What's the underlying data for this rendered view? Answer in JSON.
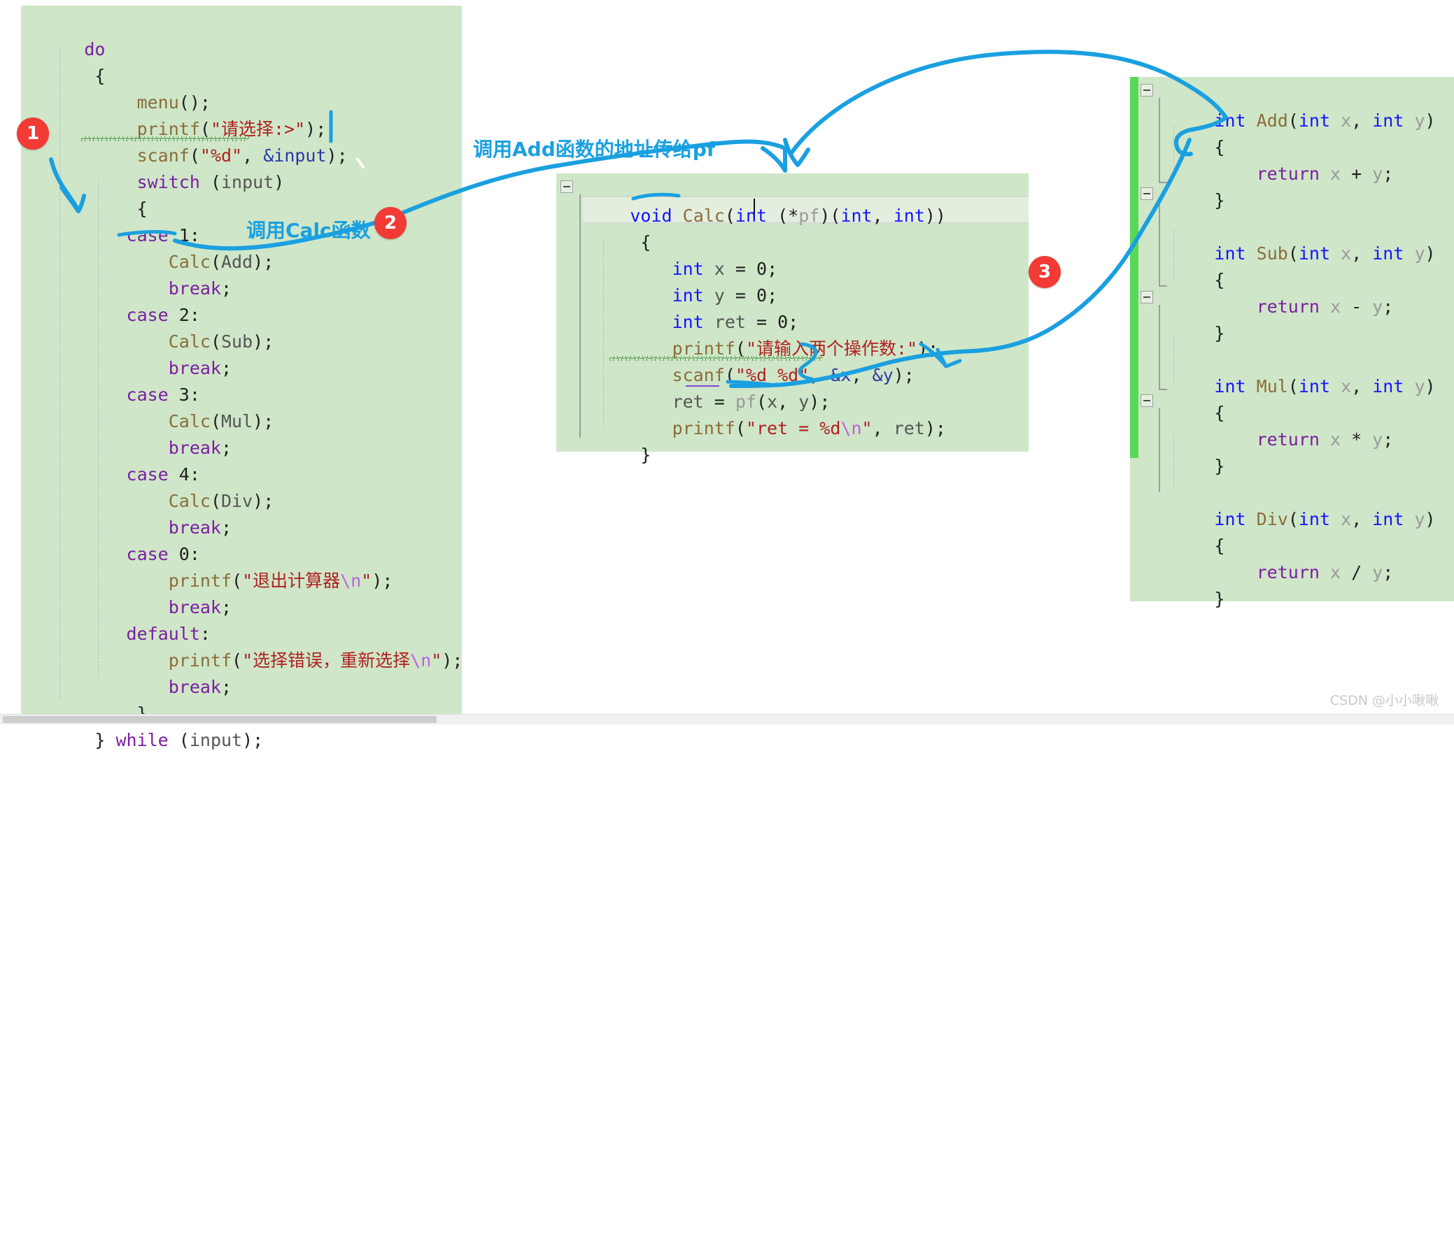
{
  "colors": {
    "code_background": "#cfe6c8",
    "page_background": "#ffffff",
    "annotation_blue": "#1aa0e0",
    "badge_red": "#f23b34",
    "changed_gutter_green": "#57d957",
    "keyword_purple": "#7b1fa2",
    "type_blue": "#1414ff",
    "function_brown": "#8a6d3b",
    "string_red": "#b02020",
    "escape_violet": "#c060e0",
    "squiggle_green": "#1f7a1f"
  },
  "panels": {
    "left": {
      "name": "main-switch-loop",
      "lines": [
        "do",
        "{",
        "    menu();",
        "    printf(\"请选择:>\");",
        "    scanf(\"%d\", &input);",
        "    switch (input)",
        "    {",
        "    case 1:",
        "        Calc(Add);",
        "        break;",
        "    case 2:",
        "        Calc(Sub);",
        "        break;",
        "    case 3:",
        "        Calc(Mul);",
        "        break;",
        "    case 4:",
        "        Calc(Div);",
        "        break;",
        "    case 0:",
        "        printf(\"退出计算器\\n\");",
        "        break;",
        "    default:",
        "        printf(\"选择错误，重新选择\\n\");",
        "        break;",
        "    }",
        "} while (input);"
      ]
    },
    "middle": {
      "name": "calc-function",
      "lines": [
        "void Calc(int (*pf)(int, int))",
        "{",
        "    int x = 0;",
        "    int y = 0;",
        "    int ret = 0;",
        "    printf(\"请输入两个操作数:\");",
        "    scanf(\"%d %d\", &x, &y);",
        "    ret = pf(x, y);",
        "    printf(\"ret = %d\\n\", ret);",
        "}"
      ]
    },
    "right": {
      "name": "operation-functions",
      "lines": [
        "int Add(int x, int y)",
        "{",
        "    return x + y;",
        "}",
        "",
        "int Sub(int x, int y)",
        "{",
        "    return x - y;",
        "}",
        "",
        "int Mul(int x, int y)",
        "{",
        "    return x * y;",
        "}",
        "",
        "int Div(int x, int y)",
        "{",
        "    return x / y;",
        "}"
      ]
    }
  },
  "annotations": {
    "note_calc_call": "调用Calc函数",
    "note_add_address": "调用Add函数的地址传给pf",
    "badges": [
      "1",
      "2",
      "3"
    ]
  },
  "watermark": "CSDN @小小啾啾"
}
